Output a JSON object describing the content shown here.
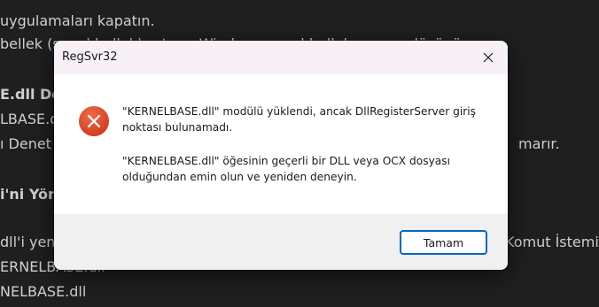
{
  "background": {
    "lines": [
      "uygulamaları kapatın.",
      "bellek (sanal bellek) artırın. Windows sanal bellek ayarını düşünün.",
      "E.dll Do",
      "LBASE.d",
      "ı Denet",
      "marır.",
      "i'ni Yön",
      "dll'i yen",
      "Komut İstemi",
      "ERNELBASE.dll",
      "NELBASE.dll"
    ]
  },
  "dialog": {
    "title": "RegSvr32",
    "close_icon": "close-icon",
    "icon": "error-icon",
    "message_line1": "\"KERNELBASE.dll\" modülü yüklendi, ancak DllRegisterServer giriş noktası bulunamadı.",
    "message_line2": "\"KERNELBASE.dll\" öğesinin geçerli bir DLL veya OCX dosyası olduğundan emin olun ve yeniden deneyin.",
    "ok_button": "Tamam"
  },
  "colors": {
    "accent": "#0067c0",
    "error": "#e0442a"
  }
}
